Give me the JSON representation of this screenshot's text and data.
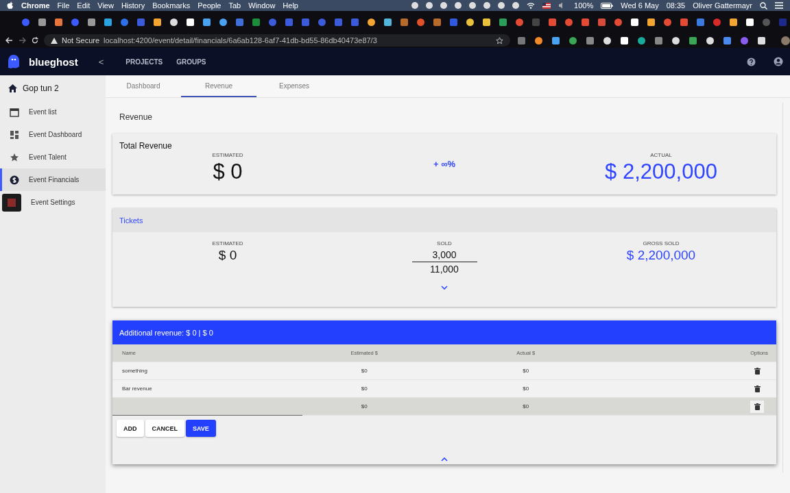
{
  "menu_bar": {
    "app": "Chrome",
    "items": [
      "File",
      "Edit",
      "View",
      "History",
      "Bookmarks",
      "People",
      "Tab",
      "Window",
      "Help"
    ],
    "battery": "100%",
    "date": "Wed 6 May",
    "time": "08:35",
    "user": "Oliver Gattermayr"
  },
  "browser": {
    "security": "Not Secure",
    "url": "localhost:4200/event/detail/financials/6a6ab128-6af7-41db-bd55-86db40473e87/3"
  },
  "header": {
    "logo": "blueghost",
    "back": "<",
    "nav": [
      "PROJECTS",
      "GROUPS"
    ]
  },
  "sidebar": {
    "title": "Gop tun 2",
    "items": [
      {
        "label": "Event list",
        "selected": false
      },
      {
        "label": "Event Dashboard",
        "selected": false
      },
      {
        "label": "Event Talent",
        "selected": false
      },
      {
        "label": "Event Financials",
        "selected": true
      },
      {
        "label": "Event Settings",
        "selected": false
      }
    ]
  },
  "tabs": [
    {
      "label": "Dashboard",
      "selected": false
    },
    {
      "label": "Revenue",
      "selected": true
    },
    {
      "label": "Expenses",
      "selected": false
    }
  ],
  "page_title": "Revenue",
  "total_revenue": {
    "title": "Total Revenue",
    "estimated_label": "ESTIMATED",
    "estimated": "$ 0",
    "change": "+ ∞%",
    "actual_label": "ACTUAL",
    "actual": "$ 2,200,000"
  },
  "tickets": {
    "title": "Tickets",
    "estimated_label": "ESTIMATED",
    "estimated": "$ 0",
    "sold_label": "SOLD",
    "sold": "3,000",
    "capacity": "11,000",
    "gross_label": "GROSS SOLD",
    "gross": "$ 2,200,000"
  },
  "additional": {
    "title": "Additional revenue: $ 0 | $ 0",
    "columns": [
      "Name",
      "Estimated $",
      "Actual $",
      "Options"
    ],
    "rows": [
      {
        "name": "something",
        "estimated": "$0",
        "actual": "$0",
        "editing": false
      },
      {
        "name": "Bar revenue",
        "estimated": "$0",
        "actual": "$0",
        "editing": false
      },
      {
        "name": "",
        "estimated": "$0",
        "actual": "$0",
        "editing": true
      }
    ],
    "buttons": [
      {
        "label": "ADD",
        "primary": false
      },
      {
        "label": "CANCEL",
        "primary": false
      },
      {
        "label": "SAVE",
        "primary": true
      }
    ]
  }
}
